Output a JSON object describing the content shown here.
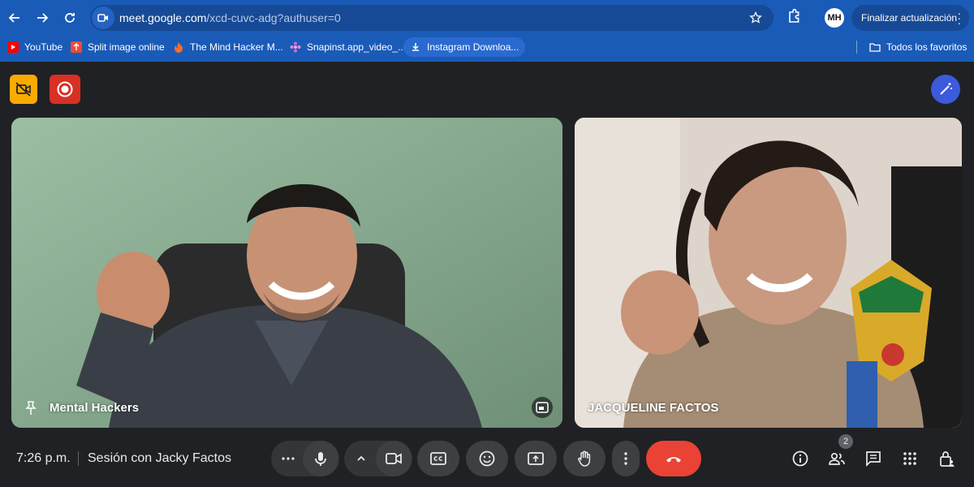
{
  "browser": {
    "url_host": "meet.google.com",
    "url_path": "/xcd-cuvc-adg?authuser=0",
    "profile_initials": "MH",
    "update_button": "Finalizar actualización",
    "bookmarks": [
      {
        "label": "YouTube",
        "icon": "youtube-icon"
      },
      {
        "label": "Split image online",
        "icon": "split-image-icon"
      },
      {
        "label": "The Mind Hacker M...",
        "icon": "flame-icon"
      },
      {
        "label": "Snapinst.app_video_...",
        "icon": "pinwheel-icon"
      },
      {
        "label": "Instagram Downloa...",
        "icon": "download-icon"
      }
    ],
    "all_bookmarks": "Todos los favoritos"
  },
  "meet": {
    "participants": [
      {
        "name": "Mental Hackers"
      },
      {
        "name": "JACQUELINE FACTOS"
      }
    ],
    "time": "7:26 p.m.",
    "meeting_title": "Sesión con Jacky Factos",
    "participant_count": "2",
    "colors": {
      "recording": "#d93025",
      "no_camera": "#f9ab00",
      "end_call": "#ea4335",
      "effects": "#3b5bdb"
    }
  }
}
